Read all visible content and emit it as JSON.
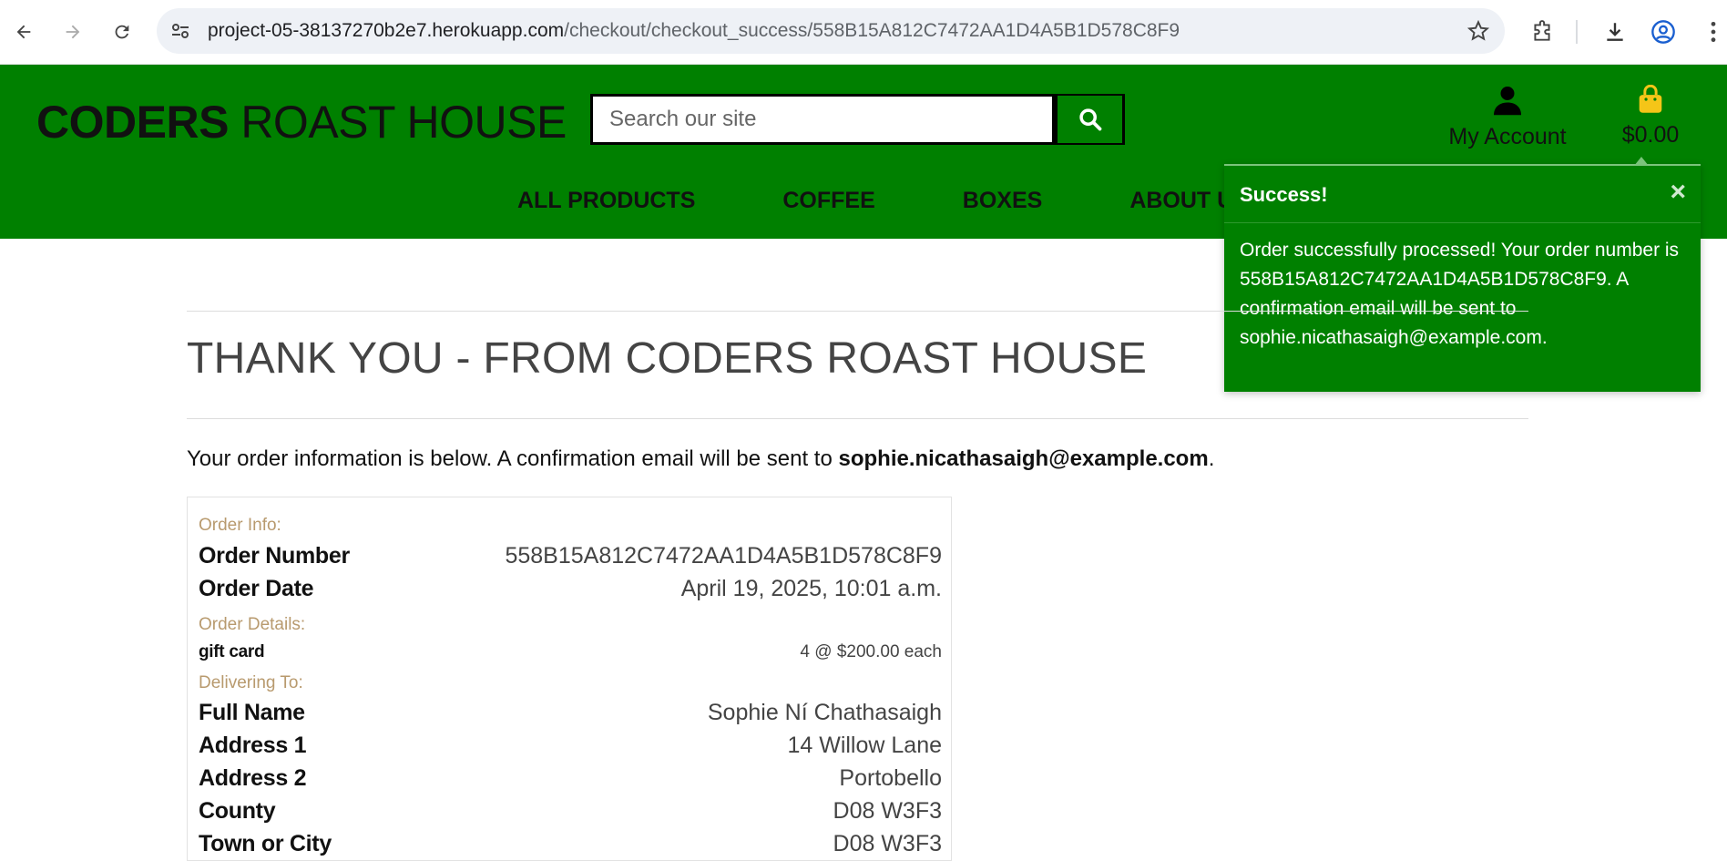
{
  "browser": {
    "url_host": "project-05-38137270b2e7.herokuapp.com",
    "url_path": "/checkout/checkout_success/558B15A812C7472AA1D4A5B1D578C8F9"
  },
  "header": {
    "logo_bold": "CODERS",
    "logo_rest": " ROAST HOUSE",
    "search_placeholder": "Search our site",
    "account_label": "My Account",
    "bag_total": "$0.00",
    "nav": [
      "ALL PRODUCTS",
      "COFFEE",
      "BOXES",
      "ABOUT US"
    ]
  },
  "toast": {
    "title": "Success!",
    "close": "×",
    "message": "Order successfully processed! Your order number is 558B15A812C7472AA1D4A5B1D578C8F9. A confirmation email will be sent to sophie.nicathasaigh@example.com."
  },
  "page": {
    "title": "THANK YOU - FROM CODERS ROAST HOUSE",
    "intro_text": "Your order information is below. A confirmation email will be sent to ",
    "intro_email": "sophie.nicathasaigh@example.com",
    "intro_end": "."
  },
  "order": {
    "info_label": "Order Info:",
    "number_key": "Order Number",
    "number_value": "558B15A812C7472AA1D4A5B1D578C8F9",
    "date_key": "Order Date",
    "date_value": "April 19, 2025, 10:01 a.m.",
    "details_label": "Order Details:",
    "item_name": "gift card",
    "item_qty": "4 @ $200.00 each",
    "delivering_label": "Delivering To:",
    "full_name_key": "Full Name",
    "full_name_value": "Sophie Ní Chathasaigh",
    "address1_key": "Address 1",
    "address1_value": "14 Willow Lane",
    "address2_key": "Address 2",
    "address2_value": "Portobello",
    "county_key": "County",
    "county_value": "D08 W3F3",
    "town_key": "Town or City",
    "town_value": "D08 W3F3"
  },
  "colors": {
    "brand_green": "#008000",
    "section_label": "#b89a6e",
    "bag_icon": "#f5c518"
  }
}
